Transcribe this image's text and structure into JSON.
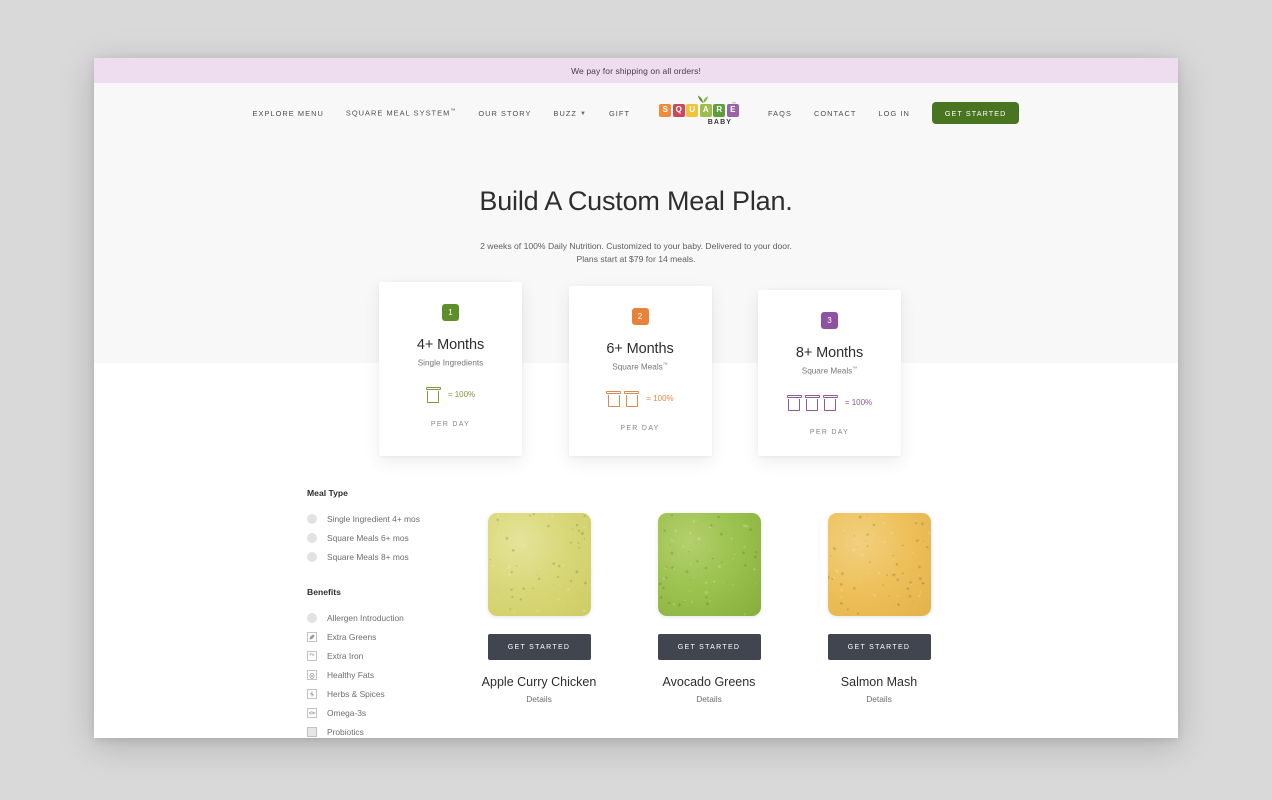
{
  "announcement": {
    "text": "We pay for shipping on all orders!"
  },
  "header": {
    "nav_left": [
      {
        "label": "EXPLORE MENU",
        "caret": false,
        "sup": ""
      },
      {
        "label": "SQUARE MEAL SYSTEM",
        "caret": false,
        "sup": "™"
      },
      {
        "label": "OUR STORY",
        "caret": false,
        "sup": ""
      },
      {
        "label": "BUZZ",
        "caret": true,
        "sup": ""
      },
      {
        "label": "GIFT",
        "caret": false,
        "sup": ""
      }
    ],
    "nav_right": [
      {
        "label": "FAQS"
      },
      {
        "label": "CONTACT"
      },
      {
        "label": "LOG IN"
      }
    ],
    "cta_label": "GET STARTED",
    "cta_color": "#4a7520",
    "logo": {
      "tiles": [
        {
          "letter": "S",
          "color": "#ef8b3a"
        },
        {
          "letter": "Q",
          "color": "#c94a5c"
        },
        {
          "letter": "U",
          "color": "#f0c33c"
        },
        {
          "letter": "A",
          "color": "#9bbf4a"
        },
        {
          "letter": "R",
          "color": "#5f9e3e"
        },
        {
          "letter": "E",
          "color": "#9a63a8"
        }
      ],
      "tm": "™",
      "wordmark": "BABY"
    }
  },
  "hero": {
    "title": "Build A Custom Meal Plan.",
    "subtitle_line1": "2 weeks of 100% Daily Nutrition. Customized to your baby. Delivered to your door.",
    "subtitle_line2": "Plans start at $79 for 14 meals."
  },
  "plans": [
    {
      "badge": "1",
      "badge_color": "#5f8f2a",
      "title": "4+ Months",
      "subtitle": "Single Ingredients",
      "subtitle_sup": "",
      "cups": 1,
      "equals": "= 100%",
      "accent": "#7d9a3f",
      "per_day": "PER DAY"
    },
    {
      "badge": "2",
      "badge_color": "#e8823a",
      "title": "6+ Months",
      "subtitle": "Square Meals",
      "subtitle_sup": "™",
      "cups": 2,
      "equals": "= 100%",
      "accent": "#d98b4e",
      "per_day": "PER DAY"
    },
    {
      "badge": "3",
      "badge_color": "#8e53a0",
      "title": "8+ Months",
      "subtitle": "Square Meals",
      "subtitle_sup": "™",
      "cups": 3,
      "equals": "= 100%",
      "accent": "#8b5a9b",
      "per_day": "PER DAY"
    }
  ],
  "filters": {
    "groups": [
      {
        "title": "Meal Type",
        "control": "radio",
        "options": [
          {
            "label": "Single Ingredient 4+ mos",
            "icon": "circle",
            "glyph": ""
          },
          {
            "label": "Square Meals 6+ mos",
            "icon": "circle",
            "glyph": ""
          },
          {
            "label": "Square Meals 8+ mos",
            "icon": "circle",
            "glyph": ""
          }
        ]
      },
      {
        "title": "Benefits",
        "control": "checkbox",
        "options": [
          {
            "label": "Allergen Introduction",
            "icon": "circle",
            "glyph": ""
          },
          {
            "label": "Extra Greens",
            "icon": "square",
            "glyph": "leaf-icon"
          },
          {
            "label": "Extra Iron",
            "icon": "square",
            "glyph": "Fe"
          },
          {
            "label": "Healthy Fats",
            "icon": "square",
            "glyph": "avocado-icon"
          },
          {
            "label": "Herbs & Spices",
            "icon": "square",
            "glyph": "herb-icon"
          },
          {
            "label": "Omega-3s",
            "icon": "square",
            "glyph": "fish-icon"
          },
          {
            "label": "Probiotics",
            "icon": "square-filled",
            "glyph": ""
          }
        ]
      }
    ]
  },
  "products": [
    {
      "name": "Apple Curry Chicken",
      "cta": "GET STARTED",
      "details": "Details",
      "color_a": "#d9d879",
      "color_b": "#cdcc63",
      "color_c": "#e5e49a"
    },
    {
      "name": "Avocado Greens",
      "cta": "GET STARTED",
      "details": "Details",
      "color_a": "#9cc24f",
      "color_b": "#86ae3c",
      "color_c": "#b4d06c"
    },
    {
      "name": "Salmon Mash",
      "cta": "GET STARTED",
      "details": "Details",
      "color_a": "#eec15c",
      "color_b": "#e3b24a",
      "color_c": "#f2d080"
    }
  ]
}
